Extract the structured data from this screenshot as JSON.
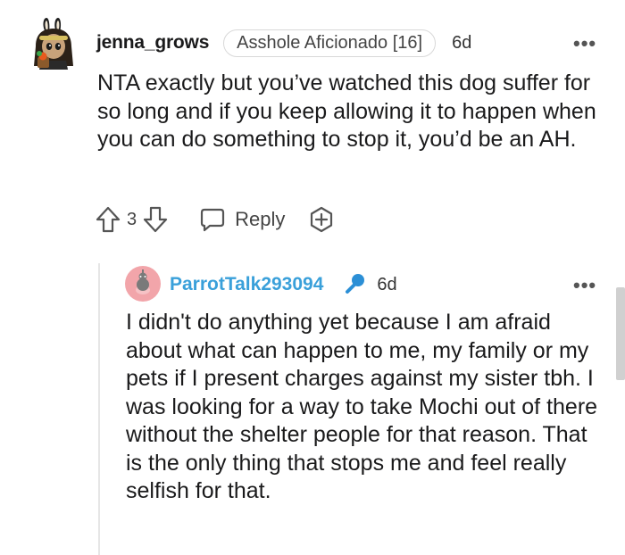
{
  "top_comment": {
    "username": "jenna_grows",
    "flair": "Asshole Aficionado [16]",
    "time": "6d",
    "more": "•••",
    "body": "NTA exactly but you’ve watched this dog suffer for so long and if you keep allowing it to happen when you can do something to stop it, you’d be an AH.",
    "vote_count": "3",
    "reply_label": "Reply"
  },
  "reply_comment": {
    "username": "ParrotTalk293094",
    "time": "6d",
    "more": "•••",
    "body": "I didn't do anything yet because I am afraid about what can happen to me, my family or my pets if I present charges against my sister tbh. I was looking for a way to take Mochi out of there without the shelter people for that reason. That is the only thing that stops me and feel really selfish for that."
  },
  "icons": {
    "upvote": "upvote-icon",
    "downvote": "downvote-icon",
    "reply": "chat-bubble-icon",
    "award": "award-plus-icon",
    "mic": "microphone-icon",
    "more": "more-options-icon"
  },
  "colors": {
    "username_reply": "#3aa0da",
    "mic": "#2b8fd6",
    "reply_avatar": "#f2a5aa",
    "text": "#1a1a1b",
    "muted": "#444444"
  }
}
